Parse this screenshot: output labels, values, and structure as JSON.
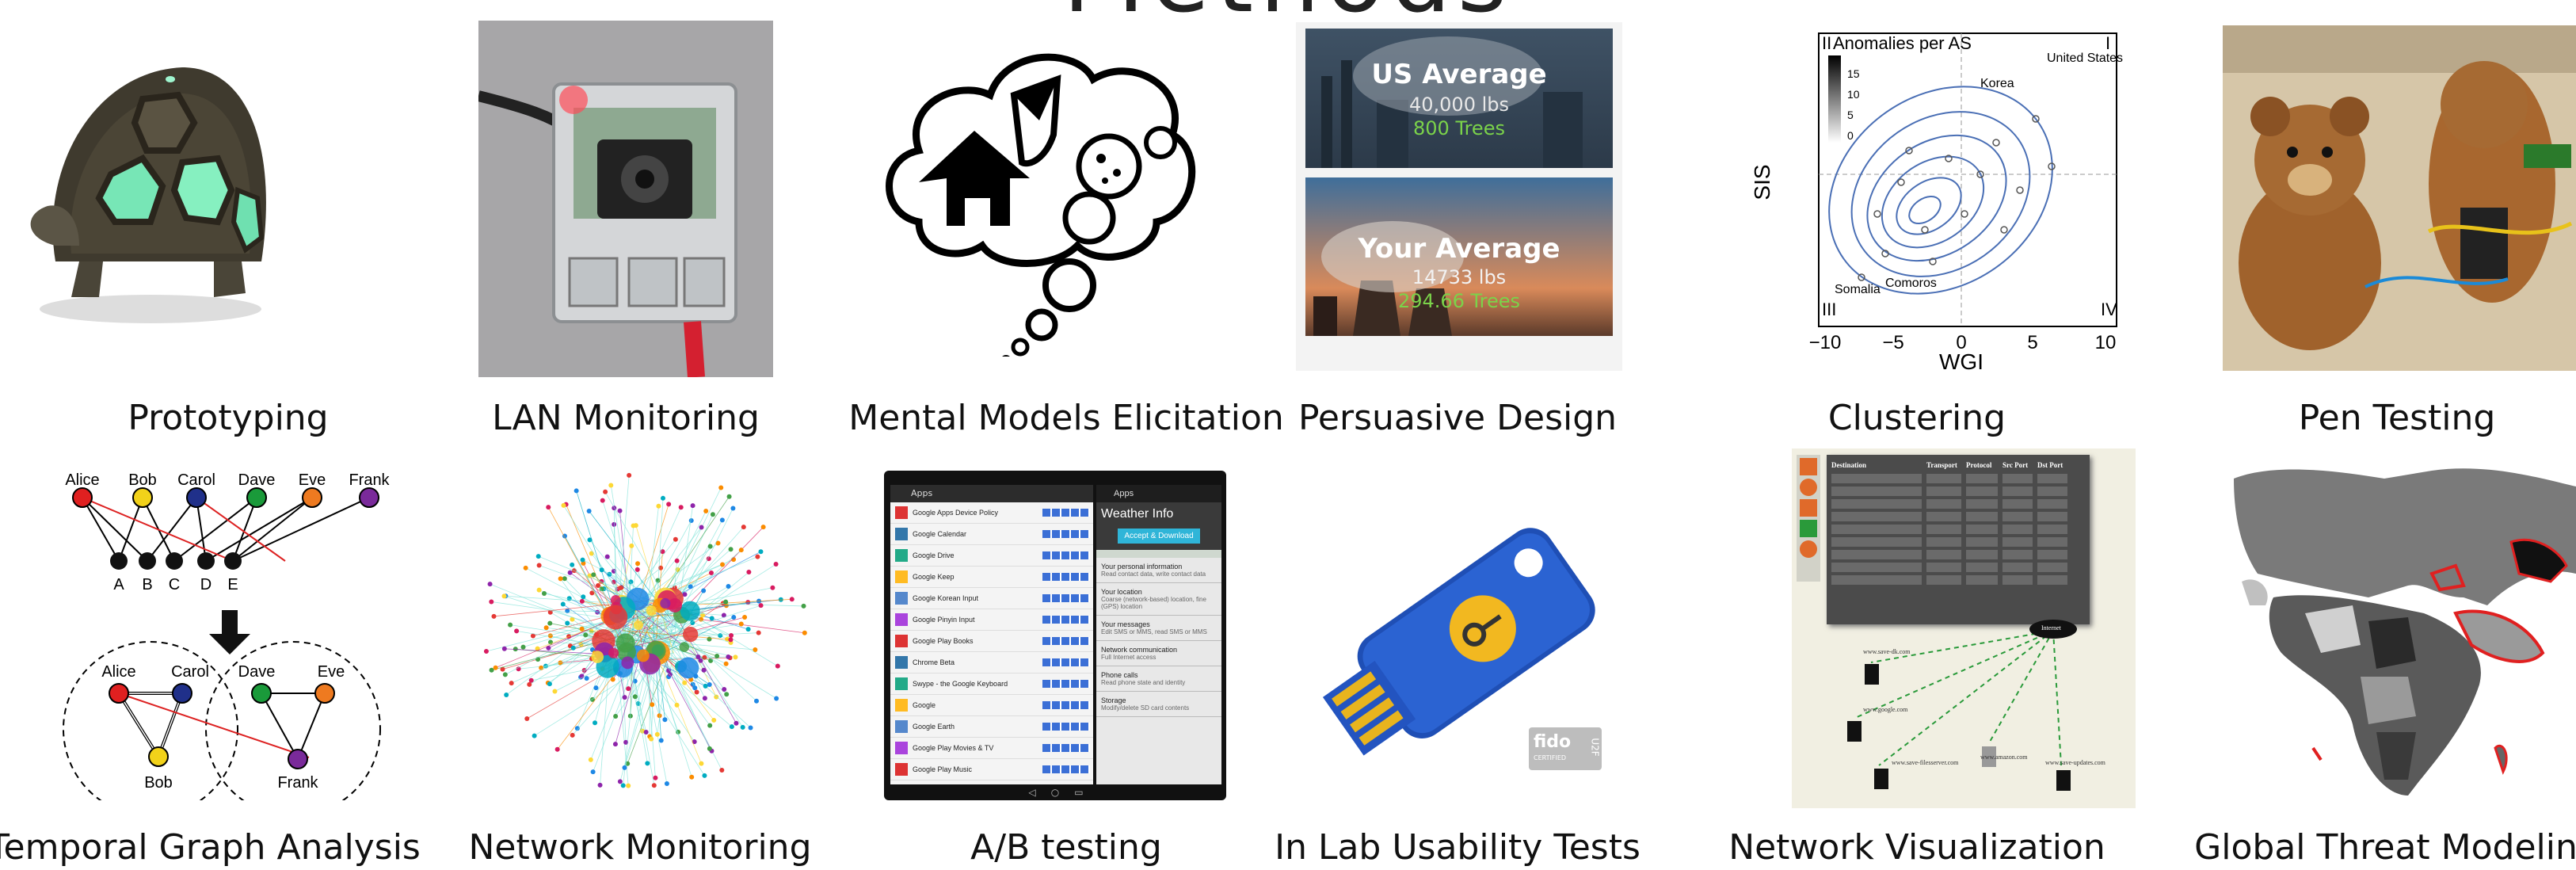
{
  "title": "Methods",
  "captions": {
    "prototyping": "Prototyping",
    "lan_monitoring": "LAN Monitoring",
    "mental_models": "Mental Models Elicitation",
    "persuasive_design": "Persuasive Design",
    "clustering": "Clustering",
    "pen_testing": "Pen Testing",
    "temporal_graph": "Temporal Graph Analysis",
    "network_monitoring": "Network Monitoring",
    "ab_testing": "A/B testing",
    "usability_tests": "In Lab Usability Tests",
    "network_visualization": "Network Visualization",
    "threat_modeling": "Global Threat Modeling"
  },
  "persuasive": {
    "top_heading": "US Average",
    "top_value": "40,000 lbs",
    "top_trees": "800 Trees",
    "bottom_heading": "Your Average",
    "bottom_value": "14733 lbs",
    "bottom_trees": "294.66 Trees"
  },
  "clustering_plot": {
    "legend_title": "Anomalies per AS",
    "legend_ticks": [
      "15",
      "10",
      "5",
      "0"
    ],
    "ylabel": "SIS",
    "xlabel": "WGI",
    "x_ticks": [
      "−10",
      "−5",
      "0",
      "5",
      "10"
    ],
    "quadrants": [
      "I",
      "II",
      "III",
      "IV"
    ],
    "points": [
      "United States",
      "Korea",
      "Somalia",
      "Comoros"
    ]
  },
  "temporal_graph": {
    "people": [
      "Alice",
      "Bob",
      "Carol",
      "Dave",
      "Eve",
      "Frank"
    ],
    "groups": [
      "A",
      "B",
      "C",
      "D",
      "E"
    ]
  },
  "ab_test": {
    "left_header": "Apps",
    "right_header": "Apps",
    "app_title": "Weather Info",
    "accept_button": "Accept & Download",
    "permissions": [
      {
        "title": "Your personal information",
        "detail": "Read contact data, write contact data"
      },
      {
        "title": "Your location",
        "detail": "Coarse (network-based) location, fine (GPS) location"
      },
      {
        "title": "Your messages",
        "detail": "Edit SMS or MMS, read SMS or MMS"
      },
      {
        "title": "Network communication",
        "detail": "Full Internet access"
      },
      {
        "title": "Phone calls",
        "detail": "Read phone state and identity"
      },
      {
        "title": "Storage",
        "detail": "Modify/delete SD card contents"
      }
    ],
    "app_rows": [
      "Google Apps Device Policy",
      "Google Calendar",
      "Google Drive",
      "Google Keep",
      "Google Korean Input",
      "Google Pinyin Input",
      "Google Play Books",
      "Chrome Beta",
      "Swype - the Google Keyboard",
      "Google",
      "Google Earth",
      "Google Play Movies & TV",
      "Google Play Music"
    ]
  },
  "netviz": {
    "columns": [
      "Destination",
      "Transport",
      "Protocol",
      "Src Port",
      "Dst Port"
    ],
    "internet_label": "Internet",
    "hosts": [
      "www.save-dk.com",
      "www.google.com",
      "www.save-filesserver.com",
      "www.amazon.com",
      "www.save-updates.com"
    ]
  },
  "usability": {
    "badge_word": "fido",
    "badge_sub": "CERTIFIED",
    "badge_side": "U2F"
  }
}
